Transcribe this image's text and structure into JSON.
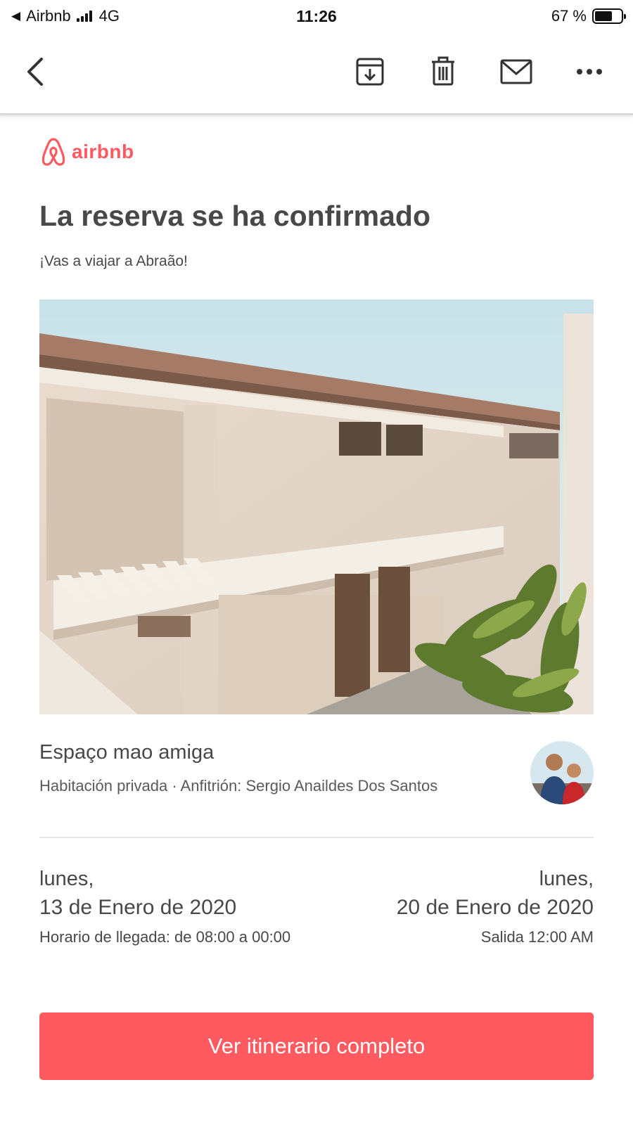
{
  "status_bar": {
    "carrier": "Airbnb",
    "network": "4G",
    "time": "11:26",
    "battery": "67 %",
    "battery_level": 0.67
  },
  "toolbar": {
    "icons": [
      "back-icon",
      "archive-icon",
      "trash-icon",
      "mail-icon",
      "more-icon"
    ]
  },
  "email": {
    "brand": "airbnb",
    "brand_color": "#ff5a5f",
    "title": "La reserva se ha confirmado",
    "subtitle": "¡Vas a viajar a Abraão!",
    "listing": {
      "name": "Espaço mao amiga",
      "meta": "Habitación privada · Anfitrión: Sergio Anaildes Dos Santos"
    },
    "checkin": {
      "day": "lunes,",
      "date": "13 de Enero de 2020",
      "note": "Horario de llegada: de 08:00 a 00:00"
    },
    "checkout": {
      "day": "lunes,",
      "date": "20 de Enero de 2020",
      "note": "Salida 12:00 AM"
    },
    "cta_label": "Ver itinerario completo"
  }
}
